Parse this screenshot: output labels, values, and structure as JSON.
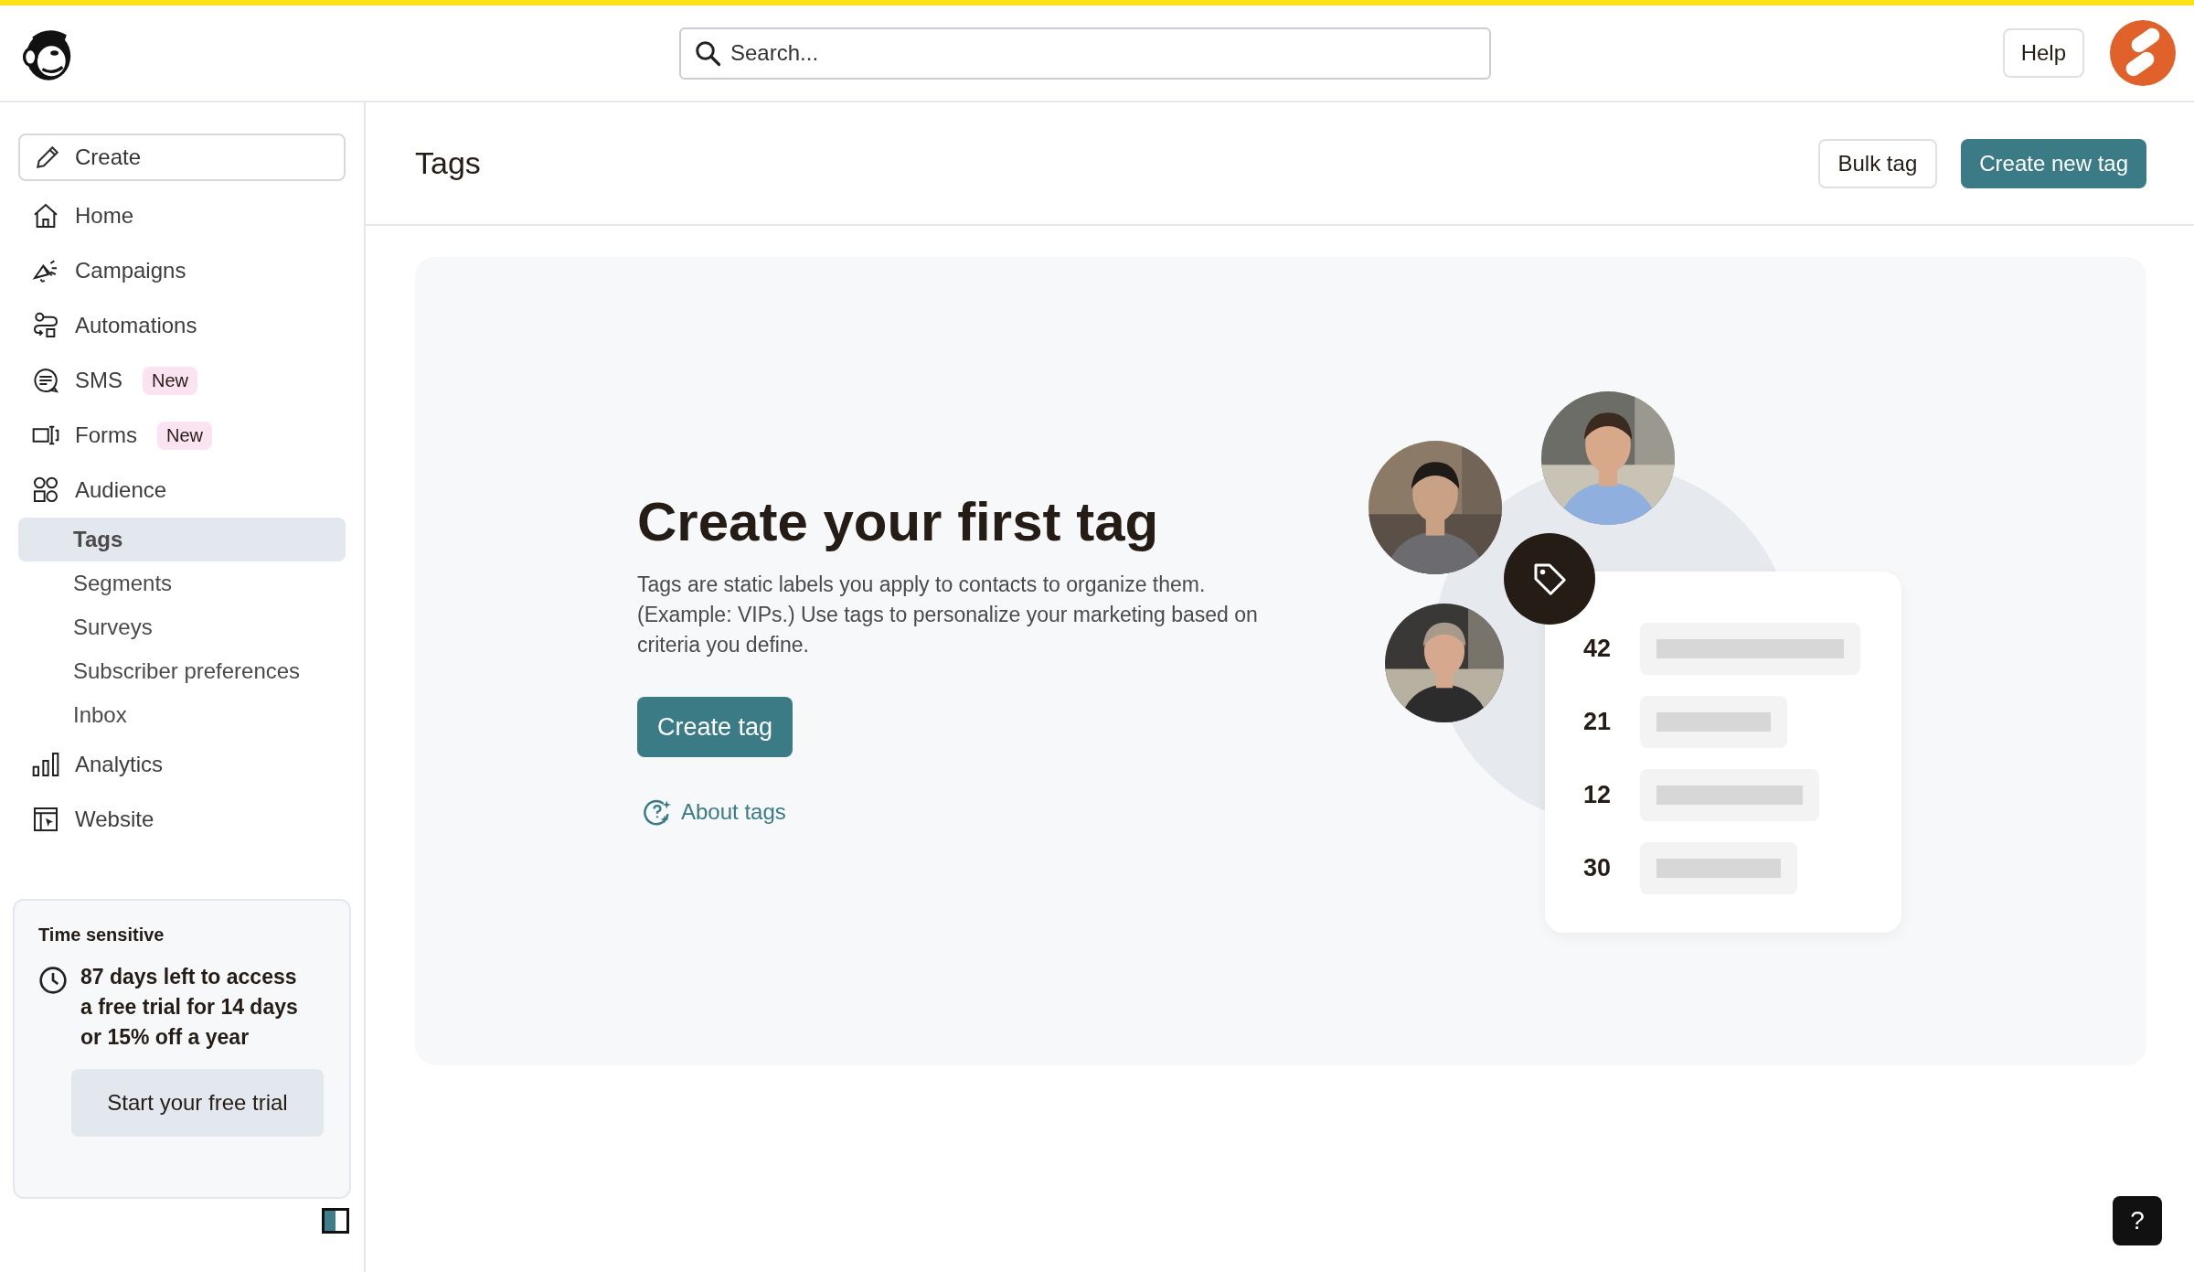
{
  "header": {
    "search": {
      "placeholder": "Search..."
    },
    "help": "Help"
  },
  "sidebar": {
    "create": "Create",
    "items": [
      {
        "label": "Home",
        "selected": false
      },
      {
        "label": "Campaigns",
        "selected": false
      },
      {
        "label": "Automations",
        "selected": false
      },
      {
        "label": "SMS",
        "badge": "New",
        "selected": false
      },
      {
        "label": "Forms",
        "badge": "New",
        "selected": false
      },
      {
        "label": "Audience",
        "selected": false,
        "children": [
          {
            "label": "Tags",
            "selected": true
          },
          {
            "label": "Segments",
            "selected": false
          },
          {
            "label": "Surveys",
            "selected": false
          },
          {
            "label": "Subscriber preferences",
            "selected": false
          },
          {
            "label": "Inbox",
            "selected": false
          }
        ]
      },
      {
        "label": "Analytics",
        "selected": false
      },
      {
        "label": "Website",
        "selected": false
      }
    ],
    "promo": {
      "kicker": "Time sensitive",
      "message": "87 days left to access a free trial for 14 days or 15% off a year",
      "button": "Start your free trial"
    }
  },
  "page": {
    "title": "Tags",
    "actions": [
      {
        "label": "Bulk tag",
        "kind": "secondary"
      },
      {
        "label": "Create new tag",
        "kind": "primary"
      }
    ]
  },
  "empty_state": {
    "heading": "Create your first tag",
    "description": "Tags are static labels you apply to contacts to organize them. (Example: VIPs.) Use tags to personalize your marketing based on criteria you define.",
    "button": "Create tag",
    "link": "About tags",
    "illustration": {
      "rows": [
        {
          "count": "42"
        },
        {
          "count": "21"
        },
        {
          "count": "12"
        },
        {
          "count": "30"
        }
      ]
    }
  },
  "help_button": "?"
}
